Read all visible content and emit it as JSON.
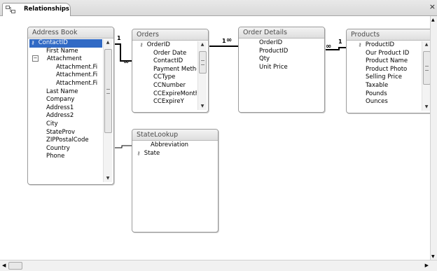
{
  "tab": {
    "label": "Relationships",
    "close": "×"
  },
  "tables": {
    "address_book": {
      "title": "Address Book",
      "fields": [
        "ContactID",
        "First Name",
        "Attachment",
        "Attachment.Fi",
        "Attachment.Fi",
        "Attachment.Fi",
        "Last Name",
        "Company",
        "Address1",
        "Address2",
        "City",
        "StateProv",
        "ZIPPostalCode",
        "Country",
        "Phone"
      ]
    },
    "orders": {
      "title": "Orders",
      "fields": [
        "OrderID",
        "Order Date",
        "ContactID",
        "Payment Method",
        "CCType",
        "CCNumber",
        "CCExpireMonth",
        "CCExpireY"
      ]
    },
    "order_details": {
      "title": "Order Details",
      "fields": [
        "OrderID",
        "ProductID",
        "Qty",
        "Unit Price"
      ]
    },
    "products": {
      "title": "Products",
      "fields": [
        "ProductID",
        "Our Product ID",
        "Product Name",
        "Product Photo",
        "Selling Price",
        "Taxable",
        "Pounds",
        "Ounces"
      ]
    },
    "state_lookup": {
      "title": "StateLookup",
      "fields": [
        "Abbreviation",
        "State"
      ]
    }
  },
  "relationships": {
    "one": "1",
    "many": "∞"
  }
}
